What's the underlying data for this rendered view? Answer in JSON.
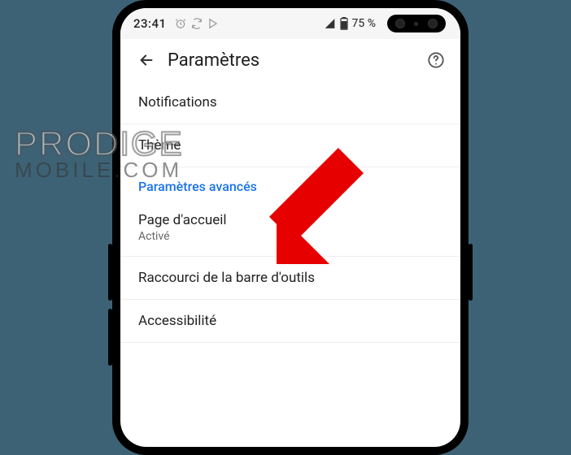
{
  "statusbar": {
    "time": "23:41",
    "battery": "75 %"
  },
  "appbar": {
    "title": "Paramètres"
  },
  "settings": {
    "notifications": "Notifications",
    "theme": "Thème",
    "advanced_header": "Paramètres avancés",
    "homepage": {
      "label": "Page d'accueil",
      "status": "Activé"
    },
    "toolbar_shortcut": "Raccourci de la barre d'outils",
    "accessibility": "Accessibilité"
  },
  "watermark": {
    "line1": "PRODIGE",
    "line2": "MOBILE.COM"
  }
}
